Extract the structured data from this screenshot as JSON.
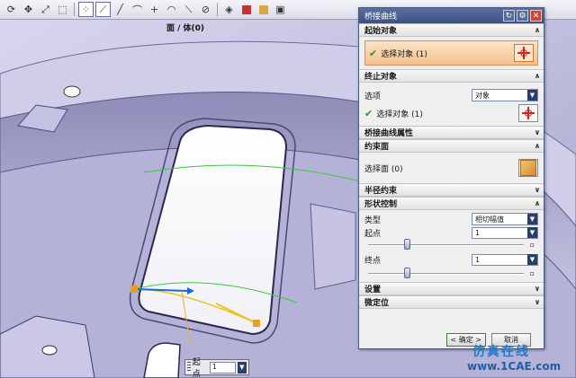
{
  "toolbar": {
    "icons": [
      "rotate-icon",
      "pan-icon",
      "fit-icon",
      "select-icon",
      "point-icon",
      "snap-icon",
      "line-icon",
      "curve-icon",
      "plus-icon",
      "arc-icon",
      "diagonal-icon",
      "mirror-icon",
      "cube-icon",
      "red-square-icon",
      "shaded-icon",
      "wireframe-icon"
    ]
  },
  "viewport": {
    "title": "面 / 体(0)",
    "float_label": "起点",
    "float_value": "1"
  },
  "dialog": {
    "title": "桥接曲线",
    "start": {
      "header": "起始对象",
      "select_label": "选择对象 (1)"
    },
    "end": {
      "header": "终止对象",
      "option_label": "选项",
      "option_value": "对象",
      "select_label": "选择对象 (1)"
    },
    "bridge_props": {
      "header": "桥接曲线属性"
    },
    "constraint_face": {
      "header": "约束面",
      "select_label": "选择面 (0)"
    },
    "radius": {
      "header": "半径约束"
    },
    "shape": {
      "header": "形状控制",
      "type_label": "类型",
      "type_value": "相切幅值",
      "start_label": "起点",
      "start_value": "1",
      "end_label": "终点",
      "end_value": "1",
      "start_slider": 0.25,
      "end_slider": 0.25,
      "slider_tick": "▫"
    },
    "settings": {
      "header": "设置"
    },
    "fine_pos": {
      "header": "微定位"
    },
    "ok_label": "< 确定 >",
    "cancel_label": "取消"
  },
  "watermark": {
    "line1": "仿真在线",
    "line2": "www.1CAE.com"
  },
  "colors": {
    "title_bar": "#3d5086",
    "highlight": "#f3c08e",
    "model_face": "#c8c6e2",
    "curve_green": "#3cc83c"
  }
}
